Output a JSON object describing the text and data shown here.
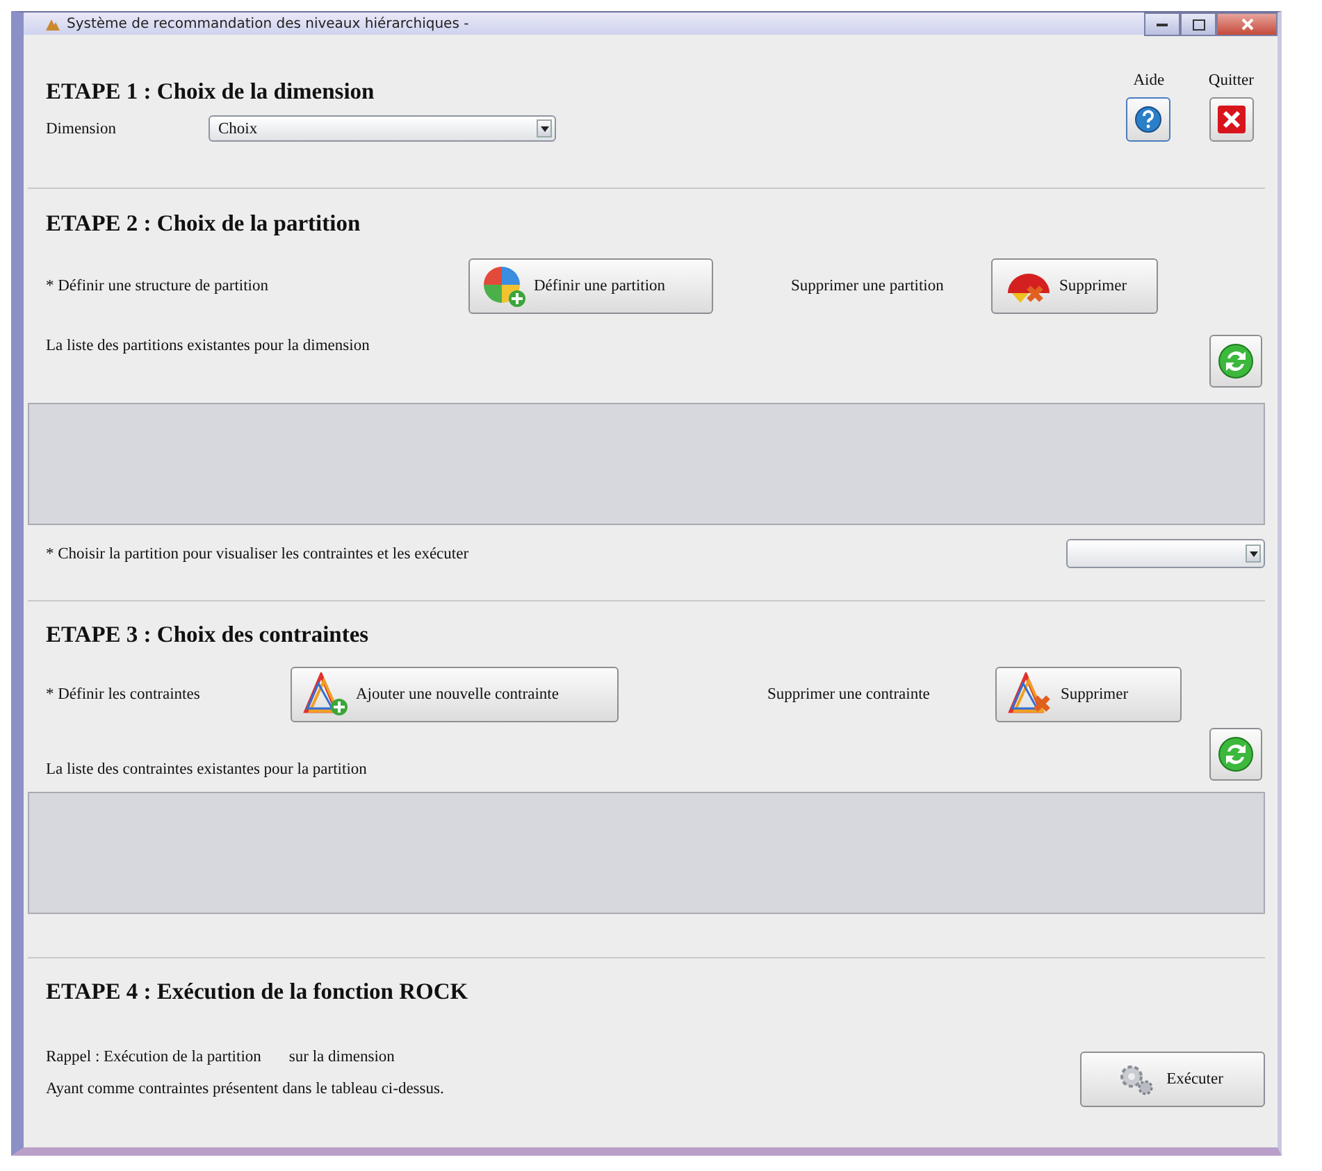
{
  "window": {
    "title": "Système de recommandation des niveaux hiérarchiques -"
  },
  "header_actions": [
    {
      "kind": "help",
      "label": "Aide"
    },
    {
      "kind": "quit",
      "label": "Quitter"
    }
  ],
  "steps": [
    {
      "title": "ETAPE 1 : Choix de la dimension",
      "rows": [
        {
          "kind": "combo",
          "label": "Dimension",
          "value": "Choix"
        }
      ]
    },
    {
      "title": "ETAPE 2 : Choix de la partition",
      "rows": [
        {
          "kind": "actions",
          "label": "* Définir une structure de partition",
          "button": {
            "kind": "partition_add",
            "label": "Définir une partition"
          },
          "label2": "Supprimer une partition",
          "button2": {
            "kind": "partition_remove",
            "label": "Supprimer"
          }
        },
        {
          "kind": "list",
          "label": "La liste des partitions existantes pour la dimension"
        },
        {
          "kind": "table"
        },
        {
          "kind": "select",
          "label": "* Choisir la partition pour visualiser les contraintes et les exécuter"
        }
      ]
    },
    {
      "title": "ETAPE 3 : Choix des contraintes",
      "rows": [
        {
          "kind": "actions",
          "label": "* Définir les contraintes",
          "button": {
            "kind": "constraint_add",
            "label": "Ajouter une nouvelle contrainte"
          },
          "label2": "Supprimer une contrainte",
          "button2": {
            "kind": "constraint_remove",
            "label": "Supprimer"
          }
        },
        {
          "kind": "list",
          "label": "La liste des contraintes existantes pour la partition"
        },
        {
          "kind": "table"
        }
      ]
    },
    {
      "title": "ETAPE 4 : Exécution de la fonction ROCK",
      "rows": [
        {
          "kind": "run",
          "lines": [
            [
              "Rappel : Exécution de la partition",
              "sur la dimension"
            ],
            [
              "Ayant comme contraintes présentent dans le tableau ci-dessus."
            ]
          ],
          "button": {
            "kind": "run",
            "label": "Exécuter"
          }
        }
      ]
    }
  ]
}
